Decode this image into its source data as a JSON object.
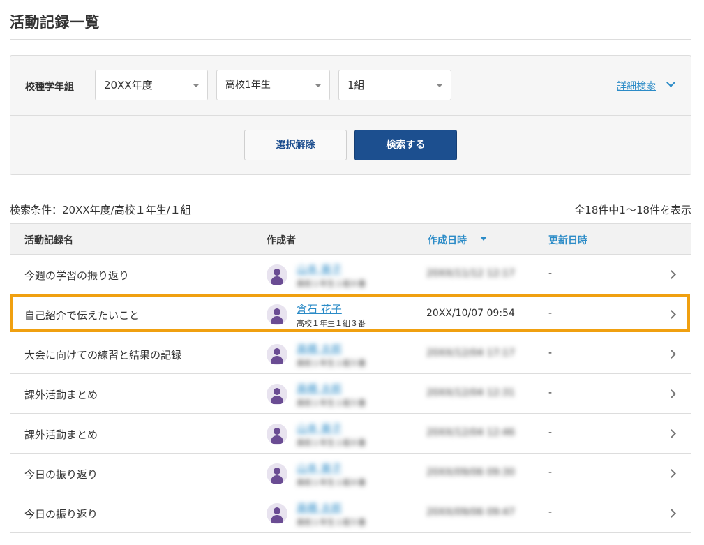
{
  "page": {
    "title": "活動記録一覧"
  },
  "filters": {
    "label": "校種学年組",
    "year": "20XX年度",
    "grade": "高校1年生",
    "class": "1組",
    "advanced_search": "詳細検索"
  },
  "buttons": {
    "clear": "選択解除",
    "search": "検索する"
  },
  "results": {
    "criteria": "検索条件：20XX年度/高校１年生/１組",
    "count": "全18件中1～18件を表示"
  },
  "table": {
    "headers": {
      "name": "活動記録名",
      "author": "作成者",
      "created": "作成日時",
      "updated": "更新日時"
    },
    "rows": [
      {
        "name": "今週の学習の振り返り",
        "author": "山本 美子",
        "author_class": "高校１年生１組８番",
        "created": "20XX/11/12 12:17",
        "updated": "-",
        "blurred": true
      },
      {
        "name": "自己紹介で伝えたいこと",
        "author": "倉石 花子",
        "author_class": "高校１年生１組３番",
        "created": "20XX/10/07 09:54",
        "updated": "-",
        "blurred": false
      },
      {
        "name": "大会に向けての練習と結果の記録",
        "author": "高橋 太郎",
        "author_class": "高校１年生１組５番",
        "created": "20XX/12/04 17:17",
        "updated": "-",
        "blurred": true
      },
      {
        "name": "課外活動まとめ",
        "author": "高橋 太郎",
        "author_class": "高校１年生１組５番",
        "created": "20XX/12/04 12:31",
        "updated": "-",
        "blurred": true
      },
      {
        "name": "課外活動まとめ",
        "author": "山本 美子",
        "author_class": "高校１年生１組８番",
        "created": "20XX/12/04 12:46",
        "updated": "-",
        "blurred": true
      },
      {
        "name": "今日の振り返り",
        "author": "山本 美子",
        "author_class": "高校１年生１組８番",
        "created": "20XX/09/06 09:30",
        "updated": "-",
        "blurred": true
      },
      {
        "name": "今日の振り返り",
        "author": "高橋 太郎",
        "author_class": "高校１年生１組５番",
        "created": "20XX/09/06 09:47",
        "updated": "-",
        "blurred": true
      }
    ]
  },
  "colors": {
    "accent": "#1c4f8f",
    "link": "#2b8bc7",
    "highlight": "#f0a010",
    "avatar": "#6a4c93"
  }
}
